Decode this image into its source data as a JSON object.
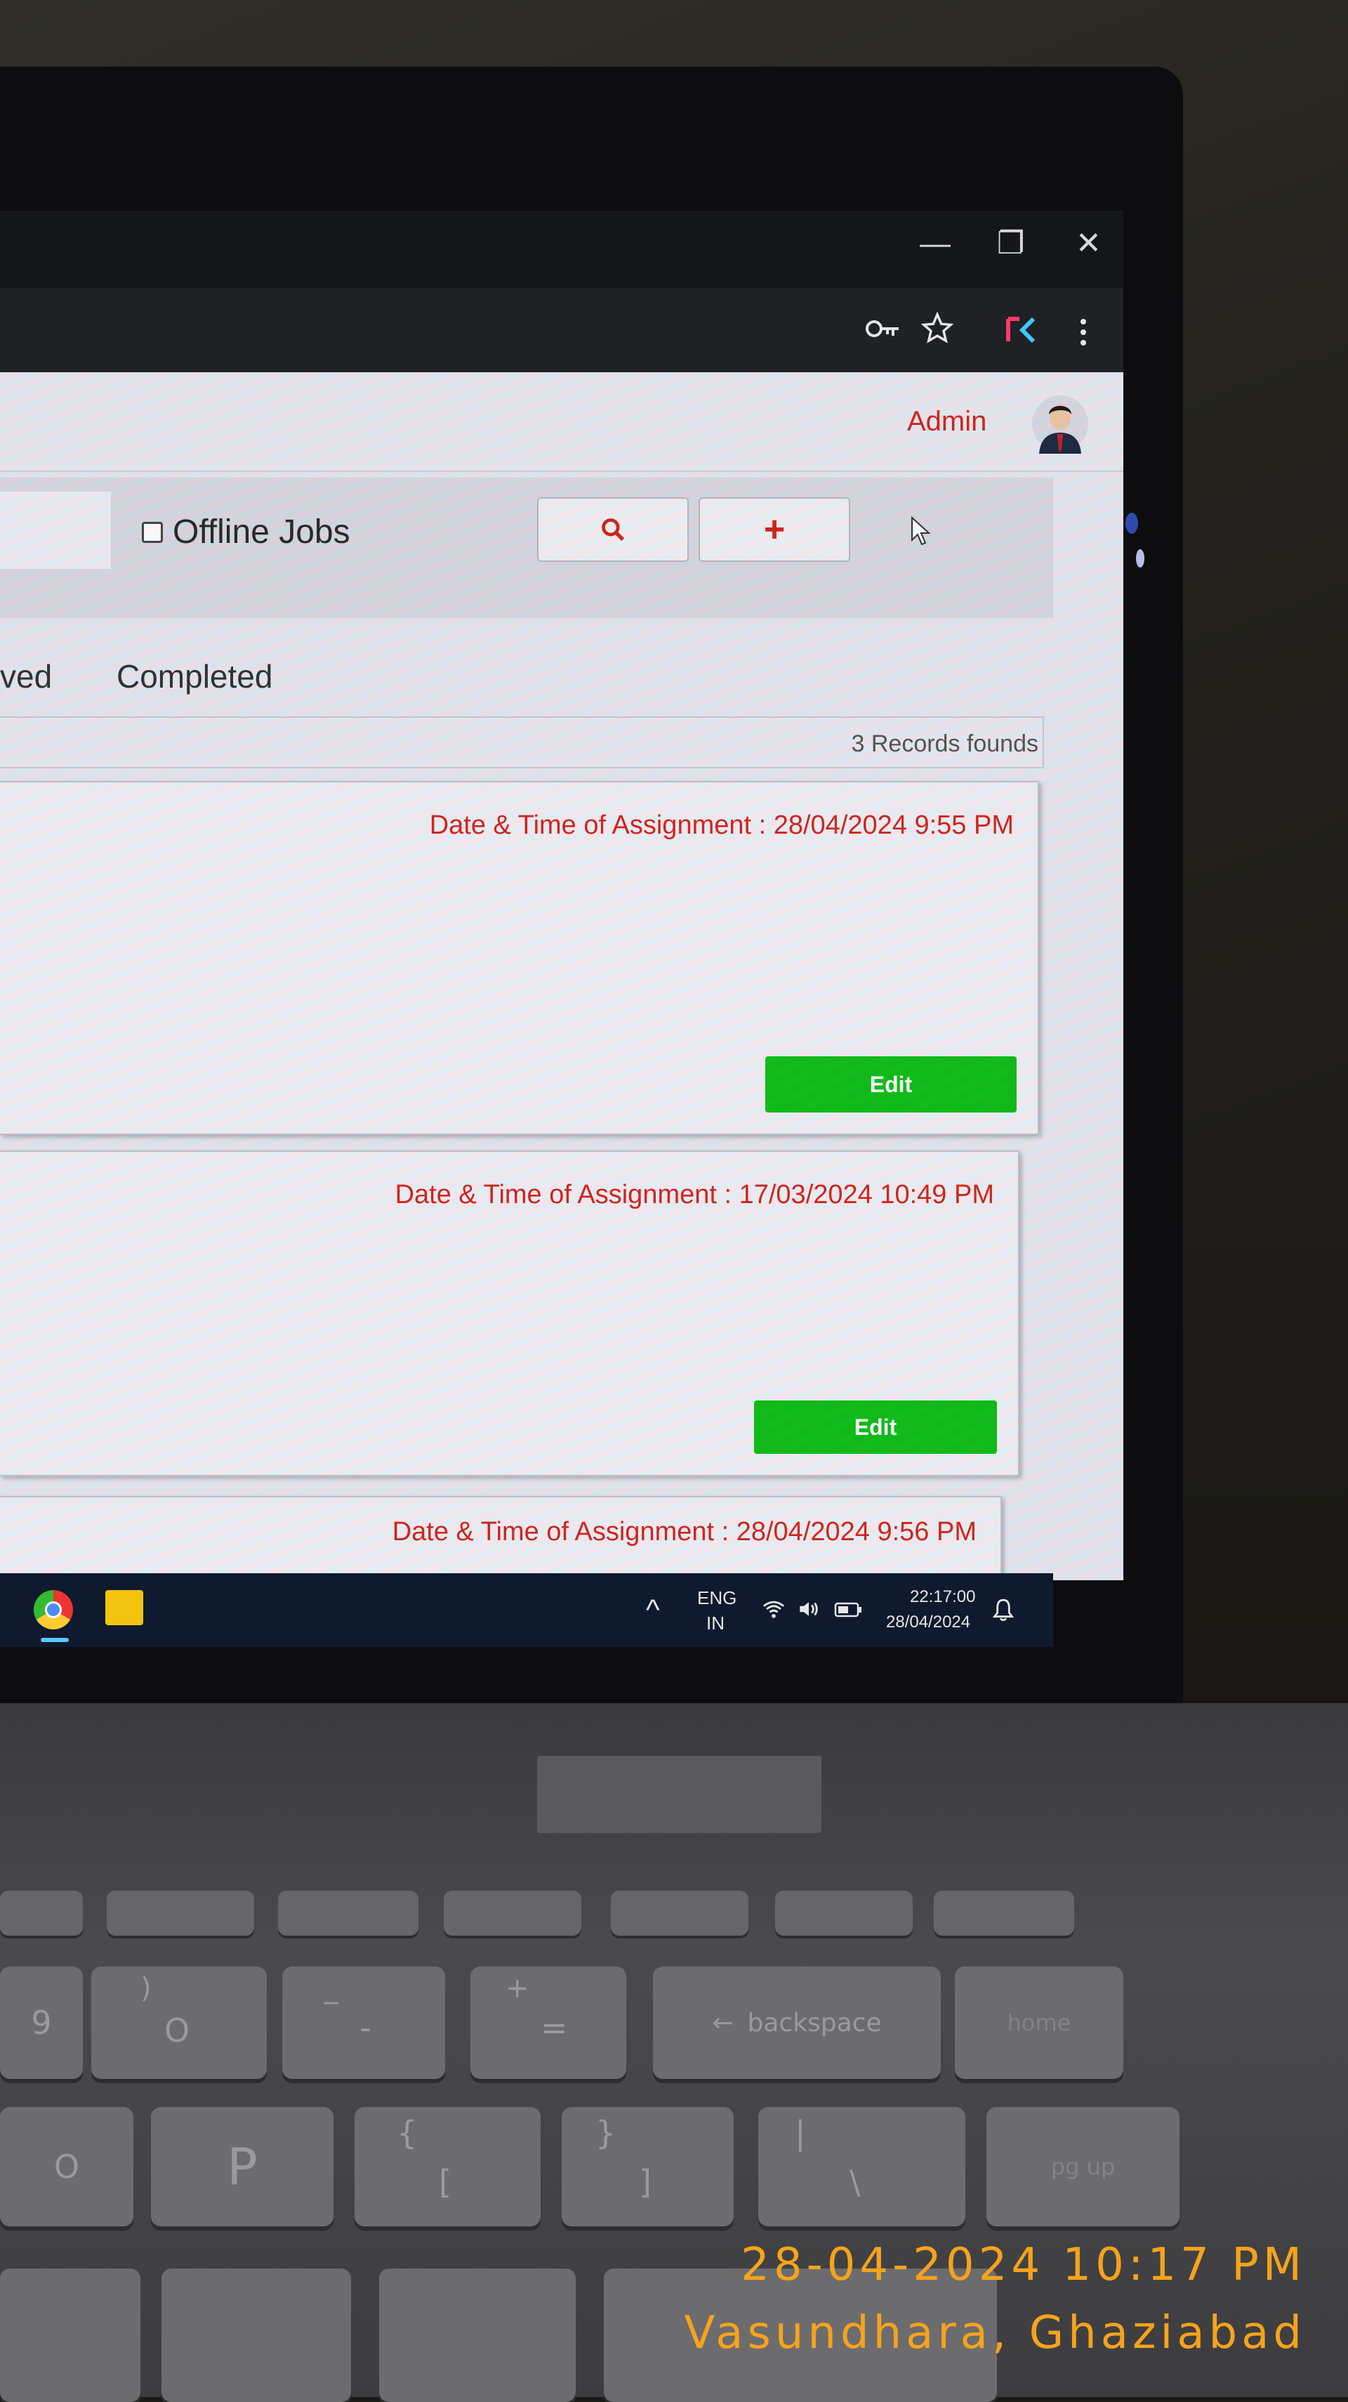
{
  "window": {
    "controls": {
      "minimize_glyph": "—",
      "restore_glyph": "❐",
      "close_glyph": "✕"
    },
    "icons": [
      "key-icon",
      "star-icon",
      "extension-icon",
      "menu-dots-icon"
    ]
  },
  "header": {
    "user_name": "Admin"
  },
  "filters": {
    "offline_label": "Offline Jobs",
    "offline_checked": false,
    "search_button_icon": "search-icon",
    "add_button_label": "+"
  },
  "tabs": [
    {
      "label": "ved"
    },
    {
      "label": "Completed"
    }
  ],
  "list": {
    "records_text": "3 Records founds",
    "cards": [
      {
        "assignment_text": "Date & Time of Assignment : 28/04/2024 9:55 PM",
        "edit_label": "Edit"
      },
      {
        "assignment_text": "Date & Time of Assignment : 17/03/2024 10:49 PM",
        "edit_label": "Edit"
      },
      {
        "assignment_text": "Date & Time of Assignment : 28/04/2024 9:56 PM"
      }
    ]
  },
  "taskbar": {
    "lang_top": "ENG",
    "lang_bottom": "IN",
    "time": "22:17:00",
    "date": "28/04/2024",
    "chevron": "^"
  },
  "keyboard": {
    "row_numbers": [
      "9",
      "O",
      "-",
      "=",
      "backspace",
      "home"
    ],
    "row_numbers_upper": [
      ")",
      "_",
      "+"
    ],
    "row_letters": [
      "O",
      "P",
      "[",
      "]",
      "\\",
      "pg up"
    ],
    "row_letters_upper": [
      "{",
      "}",
      "|"
    ]
  },
  "photo_stamp": {
    "datetime": "28-04-2024 10:17 PM",
    "location": "Vasundhara, Ghaziabad"
  },
  "colors": {
    "accent_red": "#d3261f",
    "edit_green": "#12c01a",
    "stamp_orange": "#f6a31c"
  }
}
